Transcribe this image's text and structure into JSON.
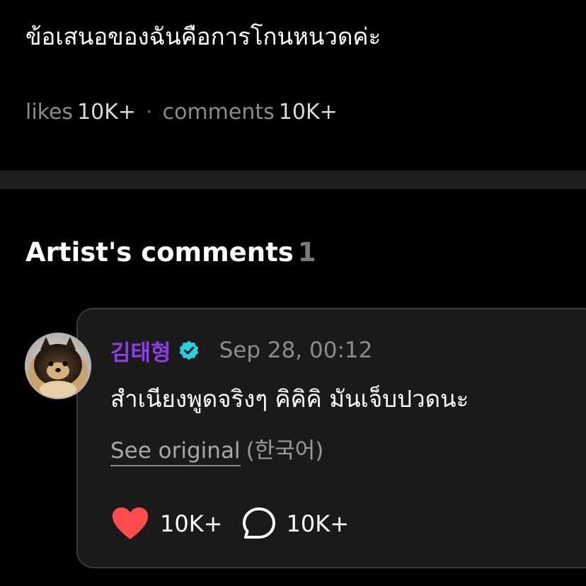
{
  "post": {
    "text": "ข้อเสนอของฉันคือการโกนหนวดค่ะ"
  },
  "stats": {
    "likes_label": "likes",
    "likes_value": "10K+",
    "separator": "·",
    "comments_label": "comments",
    "comments_value": "10K+"
  },
  "artist_comments": {
    "title": "Artist's comments",
    "count": "1"
  },
  "comment": {
    "author": "김태형",
    "timestamp": "Sep 28, 00:12",
    "text": "สำเนียงพูดจริงๆ คิคิคิ มันเจ็บปวดนะ",
    "see_original": "See original",
    "original_language": "(한국어)",
    "like_count": "10K+",
    "reply_count": "10K+"
  },
  "colors": {
    "author_name": "#8e3ee8",
    "verified_badge": "#22d3dd",
    "heart": "#ff4d4d",
    "background": "#000000",
    "card": "#1a1a1a"
  },
  "icons": {
    "verified": "verified-badge-icon",
    "like": "heart-icon",
    "reply": "speech-bubble-icon"
  }
}
